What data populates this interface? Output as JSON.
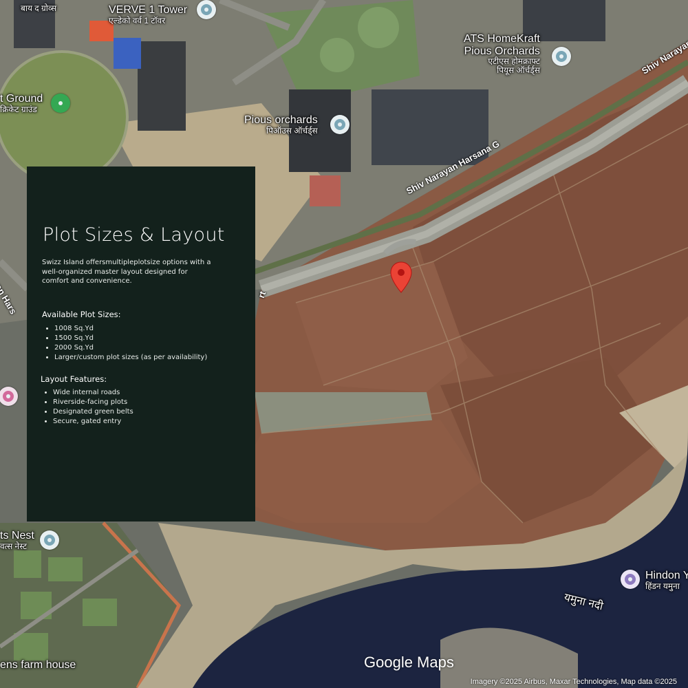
{
  "map": {
    "labels": {
      "verve_en": "VERVE 1 Tower",
      "verve_hi": "एल्डेको वर्व 1 टॉवर",
      "top_left_hi": "बाय द ग्रोव्स",
      "ats_en1": "ATS HomeKraft",
      "ats_en2": "Pious Orchards",
      "ats_hi1": "एटीएस होमक्राफ्ट",
      "ats_hi2": "पियूस ऑर्चर्ड्स",
      "ground_en": "t Ground",
      "ground_hi": "क्रिकेट ग्राउंड",
      "pious_en": "Pious orchards",
      "pious_hi": "पिऑउस ऑर्चर्ड्स",
      "road_main": "Shiv Narayan Harsana G",
      "road_top_right": "Shiv Narayan",
      "road_left": "ayan Hars",
      "nest_en": "ts Nest",
      "nest_hi": "वत्स नेस्ट",
      "farm_en": "ens farm house",
      "hindon_en": "Hindon Y",
      "hindon_hi": "हिंडन यमुना",
      "river_hi": "यमुना नदी"
    },
    "logo": "Google Maps",
    "credit": "Imagery ©2025 Airbus, Maxar Technologies, Map data ©2025",
    "colors": {
      "pin_red": "#ea4335",
      "pin_green": "#34a853",
      "pin_blue": "#7aa6b6",
      "pin_pink": "#d26a9b",
      "pin_purple": "#8e7bbf"
    }
  },
  "panel": {
    "title": "Plot Sizes & Layout",
    "intro": "Swizz Island offersmultipleplotsize options with a well-organized master layout designed for comfort and convenience.",
    "sizes_heading": "Available Plot Sizes:",
    "sizes": [
      "1008 Sq.Yd",
      "1500 Sq.Yd",
      "2000 Sq.Yd",
      "Larger/custom plot sizes (as per availability)"
    ],
    "features_heading": "Layout Features:",
    "features": [
      "Wide internal roads",
      "Riverside-facing plots",
      "Designated green belts",
      "Secure, gated entry"
    ],
    "background": "#13211c"
  }
}
